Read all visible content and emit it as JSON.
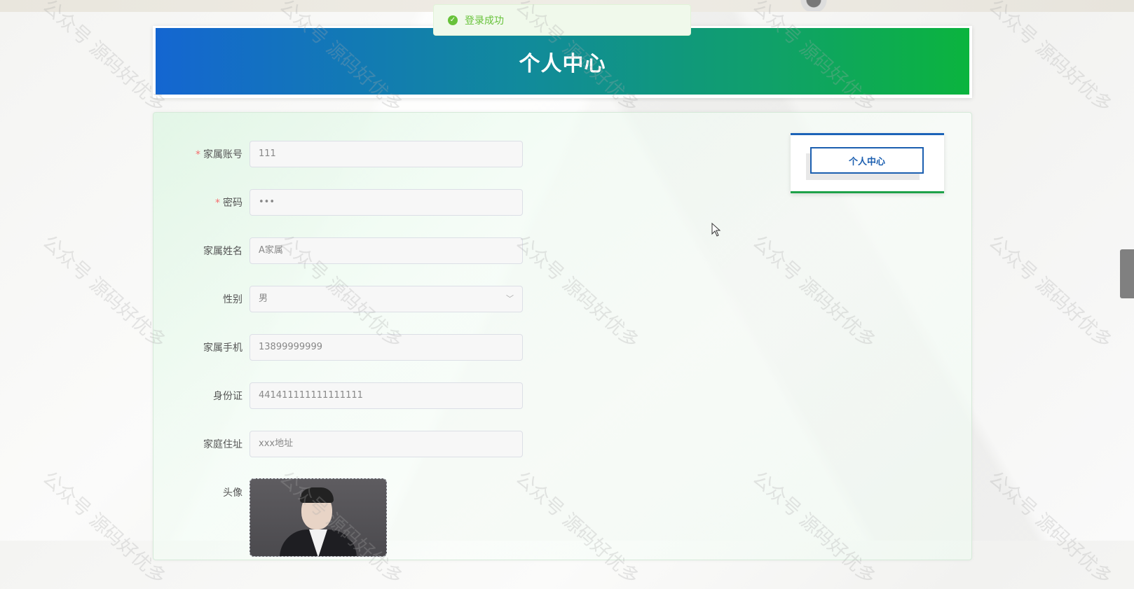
{
  "toast": {
    "message": "登录成功",
    "icon": "check-circle-icon",
    "color": "#67c23a"
  },
  "header": {
    "title": "个人中心"
  },
  "form": {
    "fields": [
      {
        "label": "家属账号",
        "required": true,
        "value": "111"
      },
      {
        "label": "密码",
        "required": true,
        "value": "•••"
      },
      {
        "label": "家属姓名",
        "required": false,
        "value": "A家属"
      },
      {
        "label": "性别",
        "required": false,
        "value": "男",
        "type": "select"
      },
      {
        "label": "家属手机",
        "required": false,
        "value": "13899999999"
      },
      {
        "label": "身份证",
        "required": false,
        "value": "441411111111111111"
      },
      {
        "label": "家庭住址",
        "required": false,
        "value": "xxx地址"
      }
    ],
    "avatar_label": "头像",
    "required_mark": "*"
  },
  "side_menu": {
    "items": [
      {
        "label": "个人中心"
      }
    ]
  },
  "watermark": {
    "text": "公众号 源码好优多"
  },
  "colors": {
    "banner_start": "#1466d1",
    "banner_end": "#0bb43e",
    "menu_accent": "#1c5fb0"
  }
}
